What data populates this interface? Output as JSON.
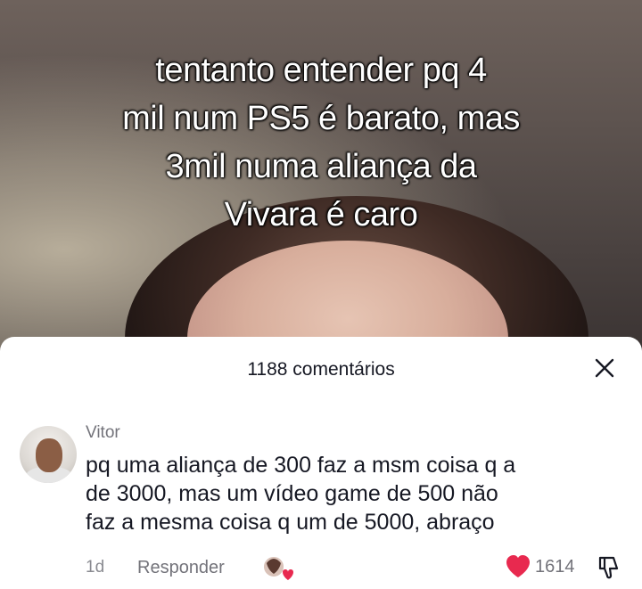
{
  "video": {
    "caption_lines": [
      "tentanto entender pq 4",
      "mil num PS5 é barato, mas",
      "3mil numa aliança da",
      "Vivara é caro"
    ]
  },
  "comments_panel": {
    "title": "1188 comentários",
    "close_icon": "close-icon"
  },
  "comment": {
    "author": "Vitor",
    "text_lines": [
      "pq uma aliança de 300 faz a msm coisa q a",
      "de 3000, mas um vídeo game de 500 não",
      "faz a mesma coisa q um de 5000, abraço"
    ],
    "time": "1d",
    "reply_label": "Responder",
    "like_count": "1614",
    "colors": {
      "heart": "#e8294f",
      "text": "#161823",
      "muted": "#73737a"
    }
  }
}
